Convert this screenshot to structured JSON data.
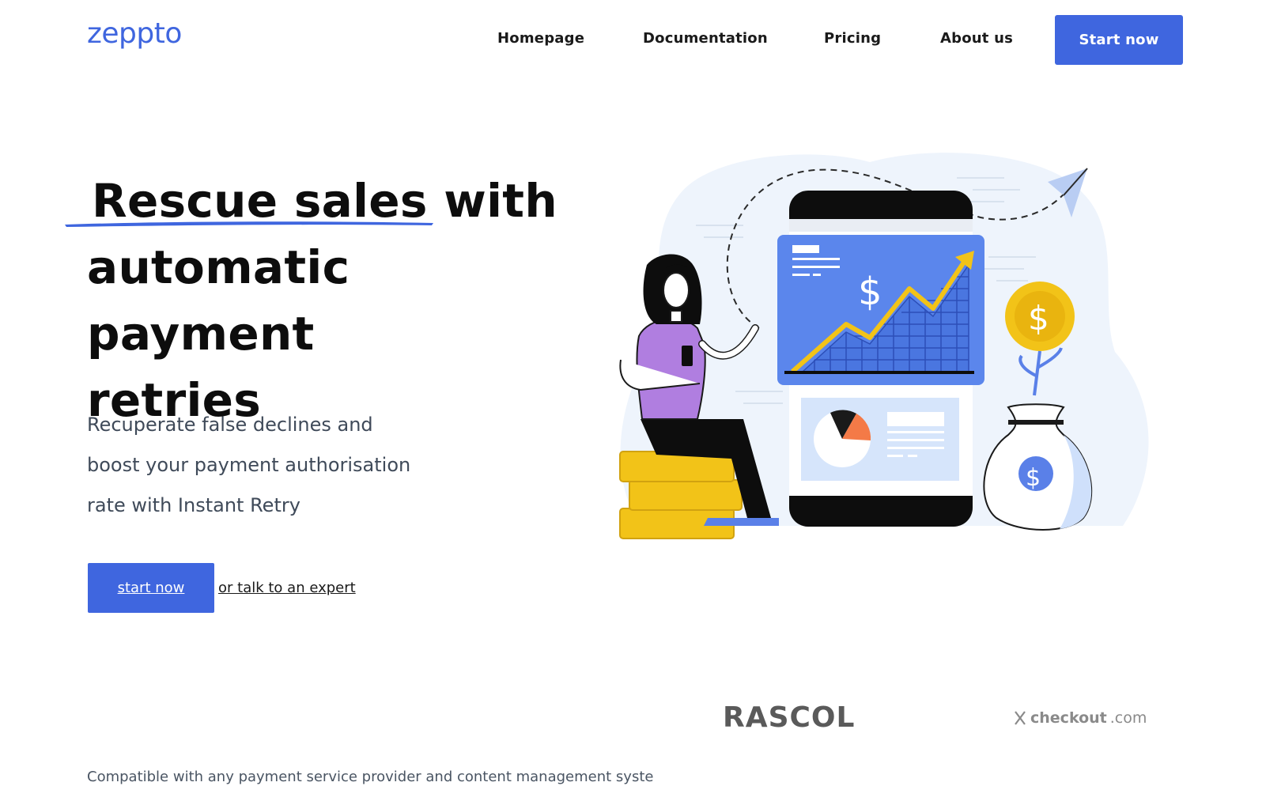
{
  "brand": {
    "logo": "zeppto",
    "color": "#3f66df"
  },
  "nav": {
    "items": [
      "Homepage",
      "Documentation",
      "Pricing",
      "About us"
    ],
    "cta": "Start now"
  },
  "hero": {
    "title_part1": "Rescue sales",
    "title_part2": "with",
    "title_line2": "automatic payment",
    "title_line3": "retries",
    "subtitle_line1": "Recuperate false declines and",
    "subtitle_line2": "boost your payment authorisation",
    "subtitle_line3": "rate with Instant Retry",
    "start_button": "start now",
    "expert_link": "or talk to an expert"
  },
  "illustration": {
    "dollar_symbol": "$"
  },
  "partners": {
    "logos": [
      "RASCOL",
      "checkout",
      ".com"
    ],
    "compatible_text": "Compatible with any payment service provider and content management syste"
  }
}
